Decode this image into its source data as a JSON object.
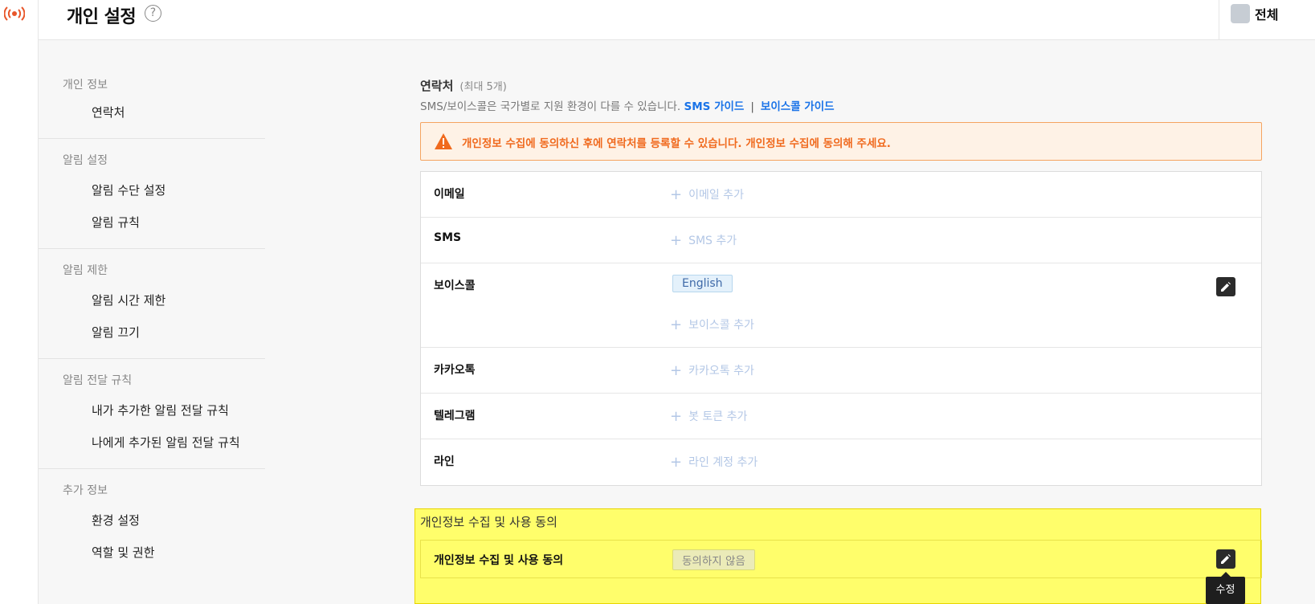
{
  "header": {
    "title": "개인 설정",
    "help": "?",
    "scope_label": "전체"
  },
  "sidebar": {
    "groups": [
      {
        "title": "개인 정보",
        "items": [
          "연락처"
        ]
      },
      {
        "title": "알림 설정",
        "items": [
          "알림 수단 설정",
          "알림 규칙"
        ]
      },
      {
        "title": "알림 제한",
        "items": [
          "알림 시간 제한",
          "알림 끄기"
        ]
      },
      {
        "title": "알림 전달 규칙",
        "items": [
          "내가 추가한 알림 전달 규칙",
          "나에게 추가된 알림 전달 규칙"
        ]
      },
      {
        "title": "추가 정보",
        "items": [
          "환경 설정",
          "역할 및 권한"
        ]
      }
    ]
  },
  "contacts": {
    "title": "연락처",
    "limit": "(최대 5개)",
    "description": "SMS/보이스콜은 국가별로 지원 환경이 다를 수 있습니다.",
    "sms_guide": "SMS 가이드",
    "separator": "|",
    "voice_guide": "보이스콜 가이드",
    "warning": "개인정보 수집에 동의하신 후에 연락처를 등록할 수 있습니다. 개인정보 수집에 동의해 주세요.",
    "rows": [
      {
        "label": "이메일",
        "add": "이메일 추가"
      },
      {
        "label": "SMS",
        "add": "SMS 추가"
      },
      {
        "label": "보이스콜",
        "tag": "English",
        "add": "보이스콜 추가"
      },
      {
        "label": "카카오톡",
        "add": "카카오톡 추가"
      },
      {
        "label": "텔레그램",
        "add": "봇 토큰 추가"
      },
      {
        "label": "라인",
        "add": "라인 계정 추가"
      }
    ]
  },
  "consent": {
    "title": "개인정보 수집 및 사용 동의",
    "row_label": "개인정보 수집 및 사용 동의",
    "status": "동의하지 않음",
    "tooltip": "수정"
  },
  "colors": {
    "accent": "#1a73e8",
    "warning": "#f06a1e",
    "highlight": "#fffe6b"
  }
}
